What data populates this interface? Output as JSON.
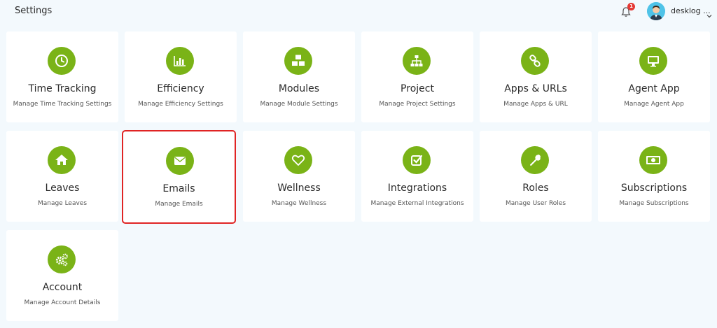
{
  "header": {
    "title": "Settings",
    "notification_count": "1",
    "user_name": "desklog ..."
  },
  "colors": {
    "accent": "#7ab317",
    "selection_outline": "#e02424",
    "badge": "#e53935",
    "background": "#f3f9fd"
  },
  "cards": [
    {
      "title": "Time Tracking",
      "subtitle": "Manage Time Tracking Settings",
      "icon": "clock-icon"
    },
    {
      "title": "Efficiency",
      "subtitle": "Manage Efficiency Settings",
      "icon": "bar-chart-icon"
    },
    {
      "title": "Modules",
      "subtitle": "Manage Module Settings",
      "icon": "cubes-icon"
    },
    {
      "title": "Project",
      "subtitle": "Manage Project Settings",
      "icon": "sitemap-icon"
    },
    {
      "title": "Apps & URLs",
      "subtitle": "Manage Apps & URL",
      "icon": "link-icon"
    },
    {
      "title": "Agent App",
      "subtitle": "Manage Agent App",
      "icon": "monitor-icon"
    },
    {
      "title": "Leaves",
      "subtitle": "Manage Leaves",
      "icon": "home-icon"
    },
    {
      "title": "Emails",
      "subtitle": "Manage Emails",
      "icon": "envelope-icon",
      "selected": true
    },
    {
      "title": "Wellness",
      "subtitle": "Manage Wellness",
      "icon": "heart-icon"
    },
    {
      "title": "Integrations",
      "subtitle": "Manage External Integrations",
      "icon": "checkbox-icon"
    },
    {
      "title": "Roles",
      "subtitle": "Manage User Roles",
      "icon": "wrench-icon"
    },
    {
      "title": "Subscriptions",
      "subtitle": "Manage Subscriptions",
      "icon": "money-icon"
    },
    {
      "title": "Account",
      "subtitle": "Manage Account Details",
      "icon": "gears-icon"
    }
  ]
}
